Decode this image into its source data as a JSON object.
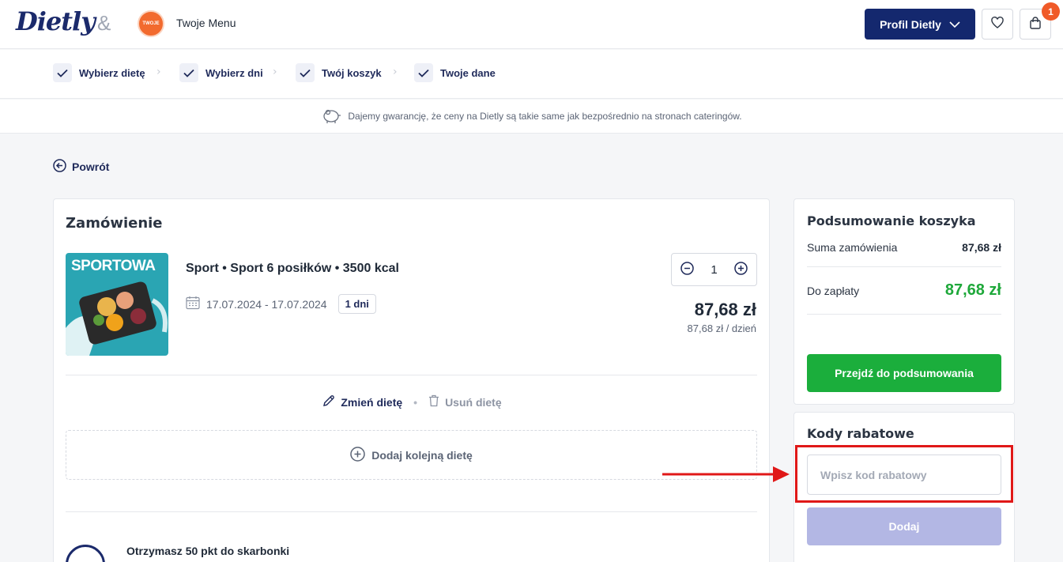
{
  "header": {
    "logo": "Dietly",
    "ampersand": "&",
    "partner_logo_text": "TWOJE Menu",
    "partner_name": "Twoje Menu",
    "profile_button": "Profil Dietly",
    "cart_count": "1"
  },
  "steps": [
    {
      "label": "Wybierz dietę"
    },
    {
      "label": "Wybierz dni"
    },
    {
      "label": "Twój koszyk"
    },
    {
      "label": "Twoje dane"
    }
  ],
  "guarantee": "Dajemy gwarancję, że ceny na Dietly są takie same jak bezpośrednio na stronach cateringów.",
  "back_label": "Powrót",
  "order": {
    "title": "Zamówienie",
    "image_label": "SPORTOWA",
    "diet_name": "Sport • Sport 6 posiłków • 3500 kcal",
    "dates": "17.07.2024 - 17.07.2024",
    "days": "1 dni",
    "quantity": "1",
    "price": "87,68 zł",
    "price_per_day": "87,68 zł / dzień",
    "edit_label": "Zmień dietę",
    "remove_label": "Usuń dietę",
    "add_diet_label": "Dodaj kolejną dietę",
    "points_text": "Otrzymasz 50 pkt do skarbonki"
  },
  "summary": {
    "title": "Podsumowanie koszyka",
    "total_label": "Suma zamówienia",
    "total_value": "87,68 zł",
    "pay_label": "Do zapłaty",
    "pay_value": "87,68 zł",
    "checkout_button": "Przejdź do podsumowania"
  },
  "discount": {
    "title": "Kody rabatowe",
    "placeholder": "Wpisz kod rabatowy",
    "value": "",
    "add_button": "Dodaj"
  },
  "colors": {
    "brand": "#14286e",
    "success": "#1bae3c",
    "badge": "#f05a28",
    "highlight": "#e01818",
    "add_button_disabled": "#b3b7e4"
  }
}
